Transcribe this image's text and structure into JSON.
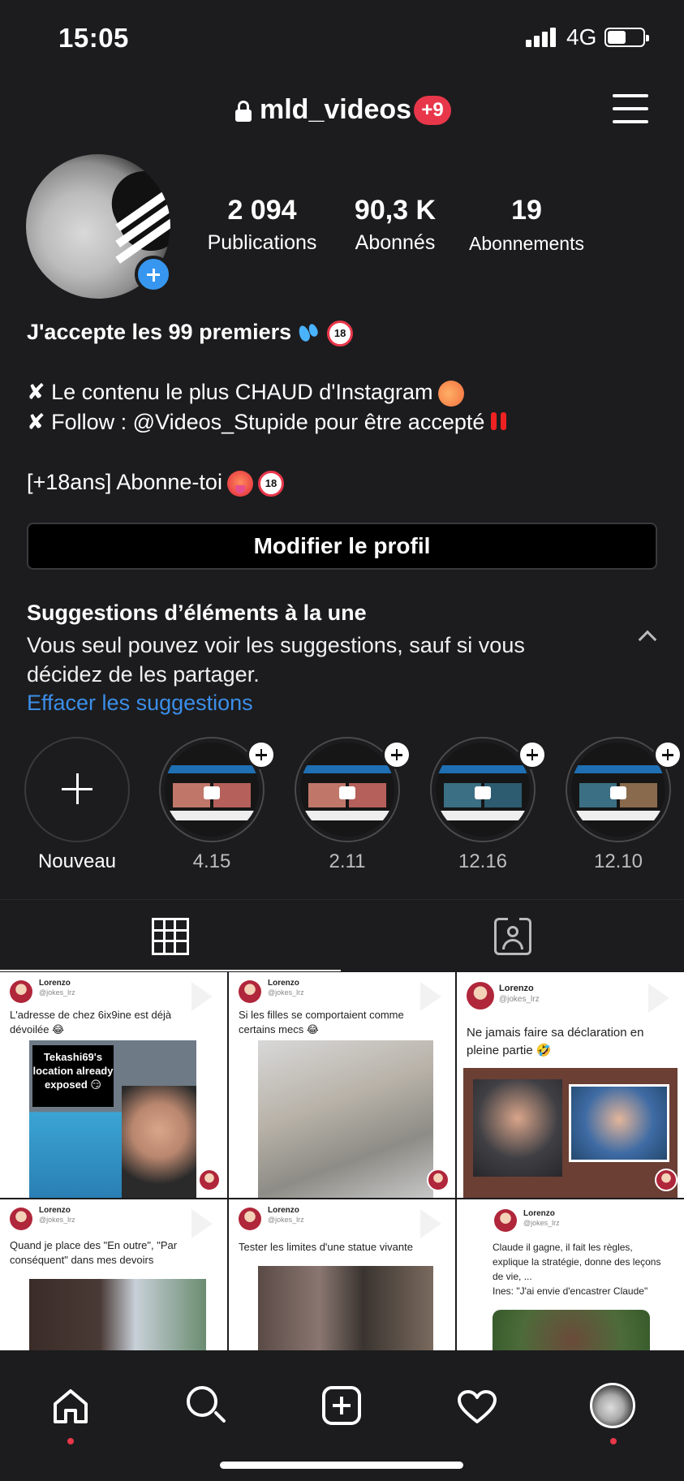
{
  "status_bar": {
    "time": "15:05",
    "network": "4G"
  },
  "header": {
    "username": "mld_videos",
    "badge": "+9"
  },
  "stats": [
    {
      "value": "2 094",
      "label": "Publications"
    },
    {
      "value": "90,3 K",
      "label": "Abonnés"
    },
    {
      "value": "19",
      "label": "Abonnements"
    }
  ],
  "bio": {
    "name": "J'accepte les 99 premiers",
    "line1": "✘ Le contenu le plus CHAUD d'Instagram",
    "line2_prefix": "✘ Follow : ",
    "line2_mention": "@Videos_Stupide",
    "line2_suffix": " pour être accepté",
    "line3": "[+18ans] Abonne-toi"
  },
  "edit_profile_label": "Modifier le profil",
  "suggestions": {
    "title": "Suggestions d’éléments à la une",
    "description": "Vous seul pouvez voir les suggestions, sauf si vous décidez de les partager.",
    "clear_link": "Effacer les suggestions"
  },
  "highlights": [
    {
      "label": "Nouveau"
    },
    {
      "label": "4.15"
    },
    {
      "label": "2.11"
    },
    {
      "label": "12.16"
    },
    {
      "label": "12.10"
    }
  ],
  "posts": [
    {
      "author": "Lorenzo",
      "handle": "@jokes_lrz",
      "text": "L'adresse de chez 6ix9ine est déjà dévoilée 😂",
      "image_caption": "Tekashi69's location already exposed 😏"
    },
    {
      "author": "Lorenzo",
      "handle": "@jokes_lrz",
      "text": "Si les filles se comportaient comme certains mecs 😂"
    },
    {
      "author": "Lorenzo",
      "handle": "@jokes_lrz",
      "text": "Ne jamais faire sa déclaration en pleine partie 🤣"
    },
    {
      "author": "Lorenzo",
      "handle": "@jokes_lrz",
      "text": "Quand je place des \"En outre\", \"Par conséquent\" dans mes devoirs"
    },
    {
      "author": "Lorenzo",
      "handle": "@jokes_lrz",
      "text": "Tester les limites d'une statue vivante"
    },
    {
      "author": "Lorenzo",
      "handle": "@jokes_lrz",
      "text": "Claude il gagne, il fait les règles, explique la stratégie, donne des leçons de vie, ...\nInes: \"J'ai envie d'encastrer Claude\""
    }
  ],
  "colors": {
    "background": "#1c1c1e",
    "accent": "#3b8ee8",
    "badge": "#e8374a"
  }
}
